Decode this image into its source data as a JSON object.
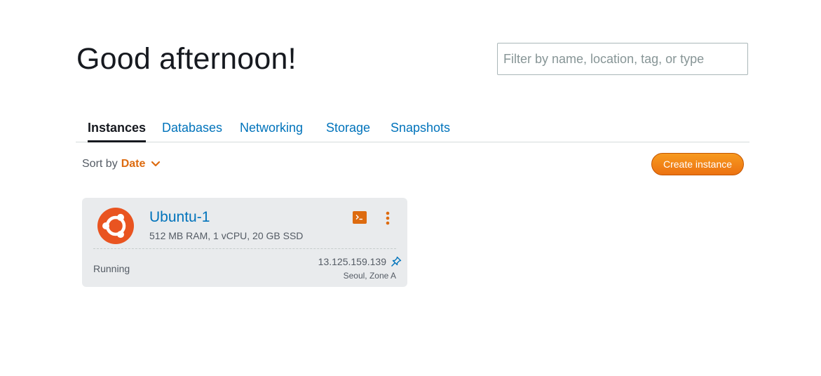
{
  "greeting": "Good afternoon!",
  "filter": {
    "placeholder": "Filter by name, location, tag, or type",
    "value": ""
  },
  "tabs": [
    {
      "label": "Instances",
      "active": true
    },
    {
      "label": "Databases",
      "active": false
    },
    {
      "label": "Networking",
      "active": false
    },
    {
      "label": "Storage",
      "active": false
    },
    {
      "label": "Snapshots",
      "active": false
    }
  ],
  "sort": {
    "label": "Sort by",
    "value": "Date",
    "icon": "chevron-down-icon"
  },
  "create_button": {
    "label": "Create instance"
  },
  "instances": [
    {
      "name": "Ubuntu-1",
      "spec": "512 MB RAM, 1 vCPU, 20 GB SSD",
      "status": "Running",
      "ip": "13.125.159.139",
      "location": "Seoul, Zone A",
      "os_icon": "ubuntu-logo-icon",
      "terminal_icon": "terminal-icon",
      "menu_icon": "more-vertical-icon",
      "pin_icon": "pin-icon"
    }
  ],
  "colors": {
    "accent": "#dd6b10",
    "link": "#0073bb",
    "ubuntu": "#e95420",
    "card_bg": "#e9ebed",
    "button": "#ec7211"
  }
}
